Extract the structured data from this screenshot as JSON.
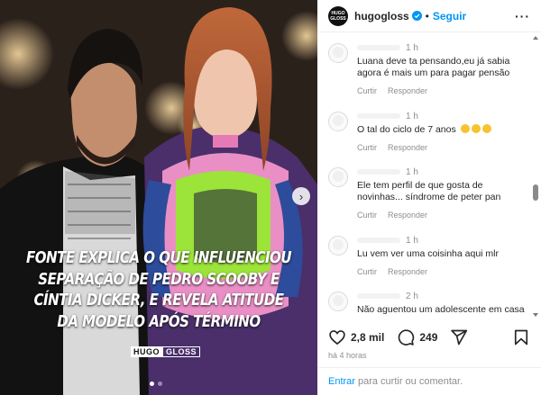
{
  "media": {
    "headline_lines": [
      "FONTE EXPLICA O QUE INFLUENCIOU",
      "SEPARAÇÃO DE PEDRO SCOOBY E",
      "CÍNTIA DICKER, E REVELA ATITUDE",
      "DA MODELO APÓS TÉRMINO"
    ],
    "logo_part1": "HUGO",
    "logo_part2": "GLOSS",
    "next_glyph": "›",
    "carousel_total": 2,
    "carousel_active": 1
  },
  "header": {
    "avatar_line1": "HUGO",
    "avatar_line2": "GLOSS",
    "username": "hugogloss",
    "separator": "•",
    "follow_label": "Seguir",
    "more_glyph": "···"
  },
  "comments": [
    {
      "time": "1 h",
      "text": "Luana deve ta pensando,eu já sabia agora é mais um para pagar pensão",
      "reply": "Curtir",
      "respond": "Responder",
      "emoji_count": 0
    },
    {
      "time": "1 h",
      "text": "O tal do ciclo de 7 anos",
      "reply": "Curtir",
      "respond": "Responder",
      "emoji_count": 3
    },
    {
      "time": "1 h",
      "text": "Ele tem perfil de que gosta de novinhas... síndrome de peter pan",
      "reply": "Curtir",
      "respond": "Responder",
      "emoji_count": 0
    },
    {
      "time": "1 h",
      "text": "Lu vem ver uma coisinha aqui mlr",
      "reply": "Curtir",
      "respond": "Responder",
      "emoji_count": 0
    },
    {
      "time": "2 h",
      "text": "Não aguentou um adolescente em casa",
      "reply": "Curtir",
      "respond": "Responder",
      "emoji_count": 0
    }
  ],
  "actions": {
    "likes": "2,8 mil",
    "comments_count": "249"
  },
  "time_ago": "há 4 horas",
  "add_comment": {
    "enter_label": "Entrar",
    "rest_label": "para curtir ou comentar."
  },
  "colors": {
    "accent": "#0095f6",
    "muted": "#8e8e8e",
    "text": "#262626"
  },
  "icons": [
    "heart-icon",
    "comment-icon",
    "share-icon",
    "bookmark-icon",
    "verified-icon",
    "chevron-right-icon"
  ]
}
